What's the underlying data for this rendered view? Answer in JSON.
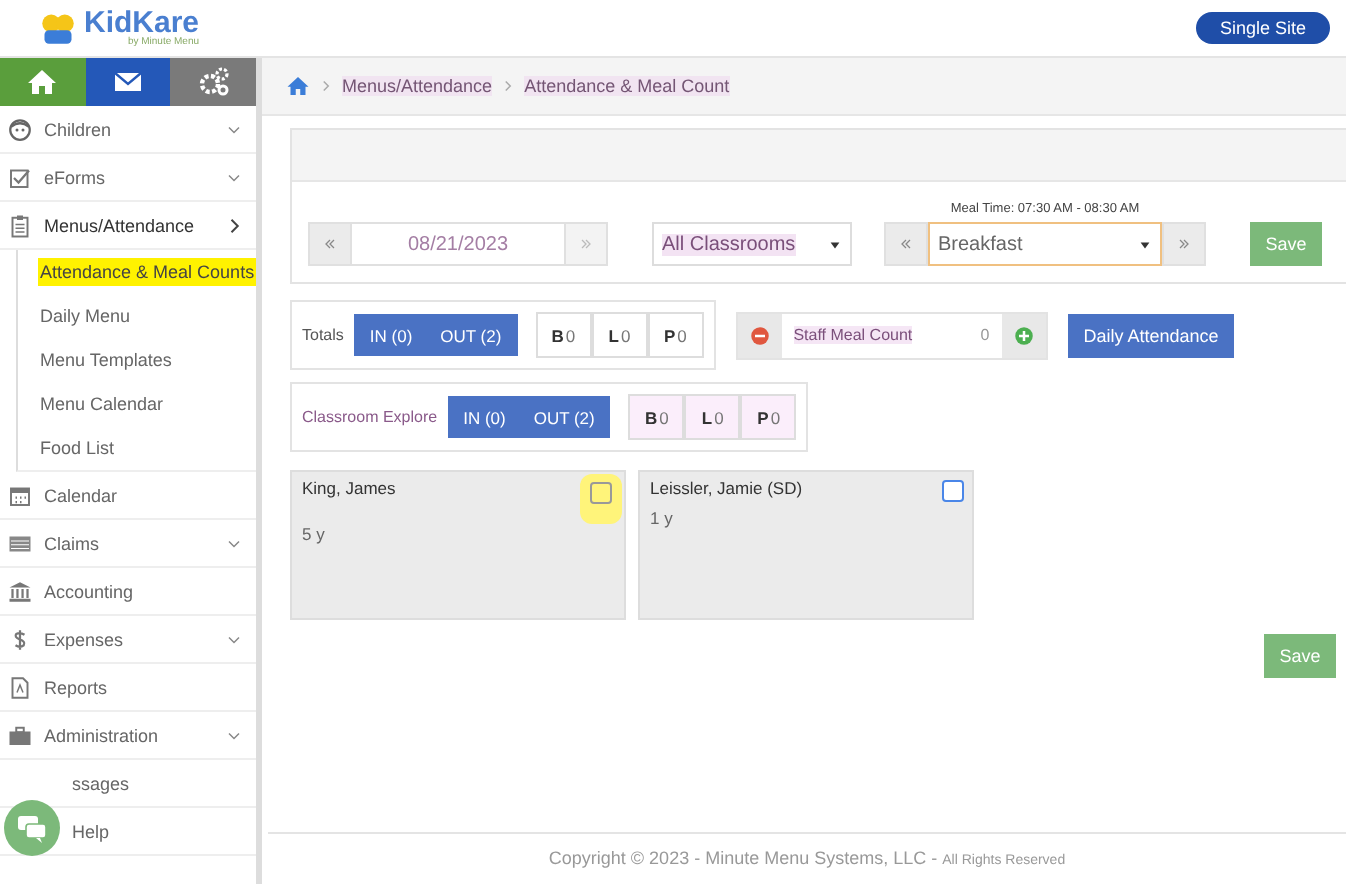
{
  "header": {
    "logo": "KidKare",
    "logo_tagline": "by Minute Menu",
    "site_button": "Single Site"
  },
  "icon_bar": [
    {
      "kind": "home",
      "color": "#5a9e3c"
    },
    {
      "kind": "mail",
      "color": "#2458b8"
    },
    {
      "kind": "gears",
      "color": "#7a7a7a"
    }
  ],
  "sidebar": {
    "items": [
      {
        "label": "Children",
        "expanded": false,
        "kind": "group"
      },
      {
        "label": "eForms",
        "expanded": false,
        "kind": "group"
      },
      {
        "label": "Menus/Attendance",
        "expanded": true,
        "kind": "group",
        "children": [
          {
            "label": "Attendance & Meal Counts",
            "selected": true
          },
          {
            "label": "Daily Menu",
            "selected": false
          },
          {
            "label": "Menu Templates",
            "selected": false
          },
          {
            "label": "Menu Calendar",
            "selected": false
          },
          {
            "label": "Food List",
            "selected": false
          }
        ]
      },
      {
        "label": "Calendar",
        "kind": "link"
      },
      {
        "label": "Claims",
        "expanded": false,
        "kind": "group"
      },
      {
        "label": "Accounting",
        "kind": "link"
      },
      {
        "label": "Expenses",
        "expanded": false,
        "kind": "group"
      },
      {
        "label": "Reports",
        "kind": "link"
      },
      {
        "label": "Administration",
        "expanded": false,
        "kind": "group"
      },
      {
        "label": "ssages",
        "kind": "link"
      },
      {
        "label": "Help",
        "kind": "link"
      }
    ]
  },
  "breadcrumb": [
    "Menus/Attendance",
    "Attendance & Meal Count"
  ],
  "controls": {
    "date": "08/21/2023",
    "classroom": "All Classrooms",
    "meal_time": "Meal Time: 07:30 AM - 08:30 AM",
    "meal": "Breakfast",
    "save": "Save"
  },
  "totals": {
    "label": "Totals",
    "in": "IN (0)",
    "out": "OUT (2)",
    "counts": [
      {
        "letter": "B",
        "value": "0"
      },
      {
        "letter": "L",
        "value": "0"
      },
      {
        "letter": "P",
        "value": "0"
      }
    ]
  },
  "staff": {
    "label": "Staff Meal Count",
    "value": "0",
    "button": "Daily Attendance"
  },
  "classroom": {
    "label": "Classroom Explore",
    "in": "IN (0)",
    "out": "OUT (2)",
    "counts": [
      {
        "letter": "B",
        "value": "0"
      },
      {
        "letter": "L",
        "value": "0"
      },
      {
        "letter": "P",
        "value": "0"
      }
    ]
  },
  "children": [
    {
      "name": "King, James",
      "age": "5 y",
      "checked": false,
      "highlighted": true
    },
    {
      "name": "Leissler, Jamie",
      "note": "(SD)",
      "age": "1 y",
      "checked": false,
      "highlighted": false
    }
  ],
  "save_bottom": "Save",
  "footer": {
    "copyright": "Copyright © 2023 - Minute Menu Systems, LLC -",
    "rights": "All Rights Reserved"
  }
}
